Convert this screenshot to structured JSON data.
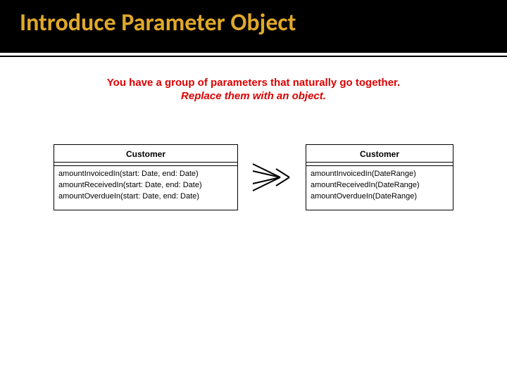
{
  "slide": {
    "title": "Introduce Parameter Object",
    "problem": "You have a group of parameters that naturally go together.",
    "solution": "Replace them with an object."
  },
  "before": {
    "class_name": "Customer",
    "methods": [
      "amountInvoicedIn(start: Date, end: Date)",
      "amountReceivedIn(start: Date, end: Date)",
      "amountOverdueIn(start: Date, end: Date)"
    ]
  },
  "after": {
    "class_name": "Customer",
    "methods": [
      "amountInvoicedIn(DateRange)",
      "amountReceivedIn(DateRange)",
      "amountOverdueIn(DateRange)"
    ]
  }
}
